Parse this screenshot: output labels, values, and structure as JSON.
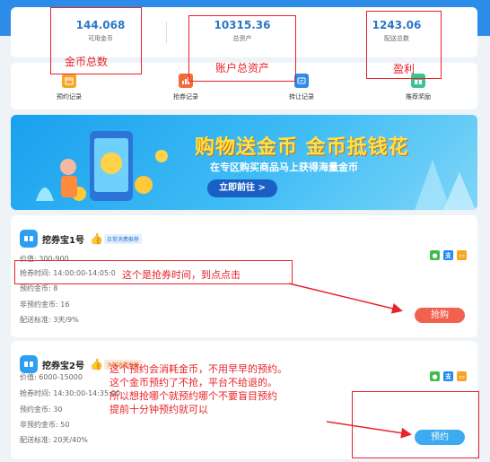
{
  "stats": [
    {
      "value": "144.068",
      "label": "可用金币"
    },
    {
      "value": "10315.36",
      "label": "总资产"
    },
    {
      "value": "1243.06",
      "label": "配送总数"
    }
  ],
  "menu": [
    {
      "label": "预约记录",
      "color": "#f5a623"
    },
    {
      "label": "抢券记录",
      "color": "#f26b3a"
    },
    {
      "label": "转让记录",
      "color": "#2d8ce8"
    },
    {
      "label": "推荐奖励",
      "color": "#3cc48e"
    }
  ],
  "banner": {
    "title": "购物送金币 金币抵钱花",
    "subtitle": "在专区购买商品马上获得海量金币",
    "button": "立即前往 >"
  },
  "products": [
    {
      "name": "挖券宝1号",
      "tag": "日常消费推荐",
      "price": "价值: 300-900",
      "time": "抢券时间: 14:00:00-14:05:0",
      "reserve_coin": "预约金币: 8",
      "non_reserve_coin": "非预约金币: 16",
      "delivery": "配送标准: 3天/9%",
      "action": "抢购"
    },
    {
      "name": "挖券宝2号",
      "tag": "大额消费推荐",
      "price": "价值: 6000-15000",
      "time": "抢券时间: 14:30:00-14:35:00",
      "reserve_coin": "预约金币: 30",
      "non_reserve_coin": "非预约金币: 50",
      "delivery": "配送标准: 20天/40%",
      "action": "预约"
    }
  ],
  "annotations": {
    "coins": "金币总数",
    "assets": "账户总资产",
    "profit": "盈利",
    "time_note": "这个是抢券时间，到点点击",
    "reserve_note": [
      "这个预约会消耗金币，不用早早的预约。",
      "这个金币预约了不抢，平台不给退的。",
      "所以想抢哪个就预约哪个不要盲目预约",
      "提前十分钟预约就可以"
    ]
  }
}
